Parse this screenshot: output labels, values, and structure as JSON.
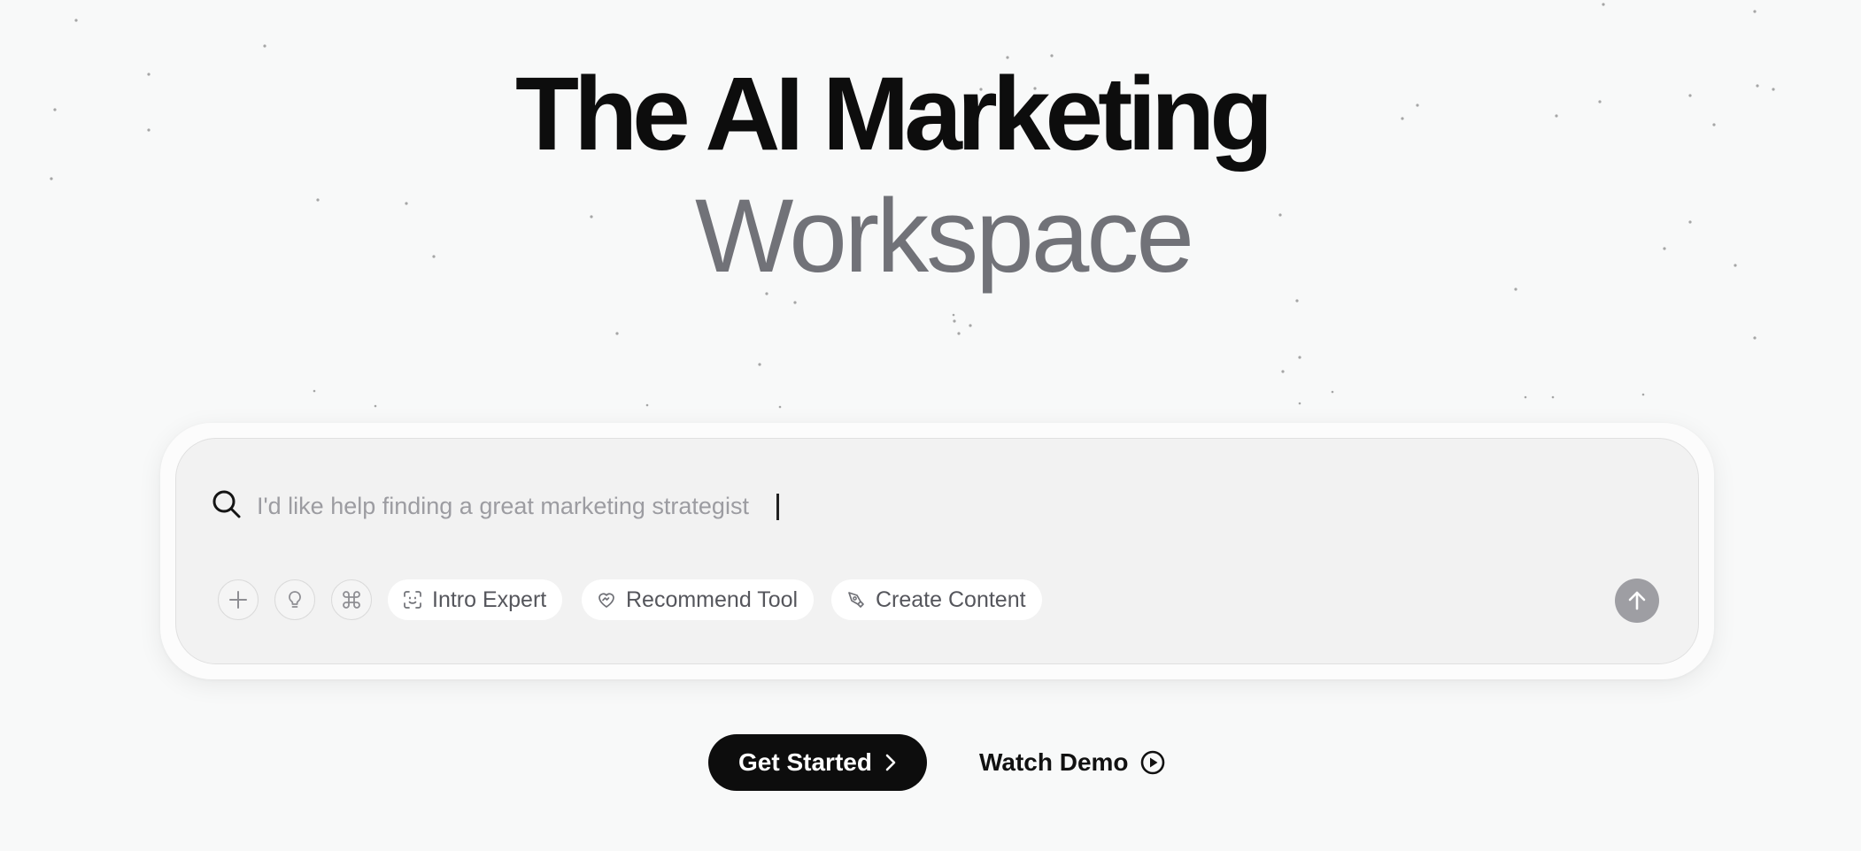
{
  "hero": {
    "title_line1": "The AI Marketing",
    "title_line2": "Workspace"
  },
  "search": {
    "placeholder": "I'd like help finding a great marketing strategist",
    "icon": "search-icon"
  },
  "toolbar": {
    "circle_buttons": [
      {
        "name": "add-button",
        "icon": "plus-icon"
      },
      {
        "name": "ideas-button",
        "icon": "lightbulb-icon"
      },
      {
        "name": "command-button",
        "icon": "command-icon"
      }
    ],
    "chips": [
      {
        "label": "Intro Expert",
        "icon": "face-scan-icon"
      },
      {
        "label": "Recommend Tool",
        "icon": "heart-handshake-icon"
      },
      {
        "label": "Create Content",
        "icon": "pen-tool-icon"
      }
    ],
    "send_icon": "arrow-up-icon"
  },
  "cta": {
    "get_started_label": "Get Started",
    "watch_demo_label": "Watch Demo"
  },
  "colors": {
    "background": "#f8f9f9",
    "title_dark": "#0d0d0d",
    "title_gray": "#717278",
    "search_fill": "#f2f2f2",
    "send_button": "#9e9ea3",
    "primary_button": "#0d0d0d"
  }
}
